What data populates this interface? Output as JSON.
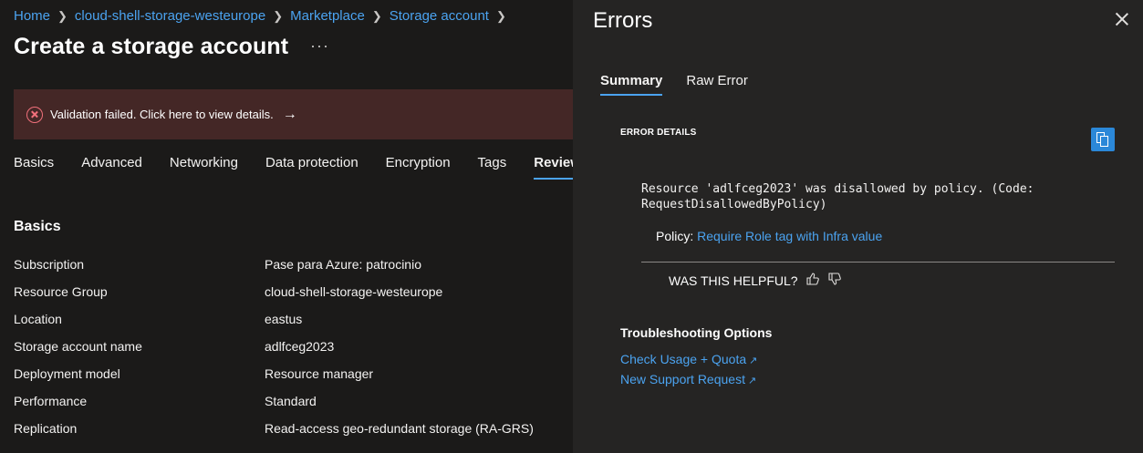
{
  "breadcrumb": [
    "Home",
    "cloud-shell-storage-westeurope",
    "Marketplace",
    "Storage account"
  ],
  "page": {
    "title": "Create a storage account",
    "more": "···"
  },
  "banner": {
    "text": "Validation failed. Click here to view details.",
    "arrow": "→"
  },
  "tabs": [
    "Basics",
    "Advanced",
    "Networking",
    "Data protection",
    "Encryption",
    "Tags",
    "Review"
  ],
  "section": {
    "title": "Basics",
    "rows": [
      {
        "key": "Subscription",
        "value": "Pase para Azure: patrocinio"
      },
      {
        "key": "Resource Group",
        "value": "cloud-shell-storage-westeurope"
      },
      {
        "key": "Location",
        "value": "eastus"
      },
      {
        "key": "Storage account name",
        "value": "adlfceg2023"
      },
      {
        "key": "Deployment model",
        "value": "Resource manager"
      },
      {
        "key": "Performance",
        "value": "Standard"
      },
      {
        "key": "Replication",
        "value": "Read-access geo-redundant storage (RA-GRS)"
      }
    ]
  },
  "panel": {
    "title": "Errors",
    "tabs": [
      "Summary",
      "Raw Error"
    ],
    "error_details_label": "ERROR DETAILS",
    "error_message": "Resource 'adlfceg2023' was disallowed by policy. (Code: RequestDisallowedByPolicy)",
    "policy_label": "Policy:",
    "policy_link": "Require Role tag with Infra value",
    "helpful": "WAS THIS HELPFUL?",
    "troubleshooting_title": "Troubleshooting Options",
    "links": [
      "Check Usage + Quota",
      "New Support Request"
    ]
  },
  "colors": {
    "link": "#4ba3f0",
    "error": "#f1707b",
    "banner_bg": "#442726",
    "accent": "#2b88d8"
  }
}
